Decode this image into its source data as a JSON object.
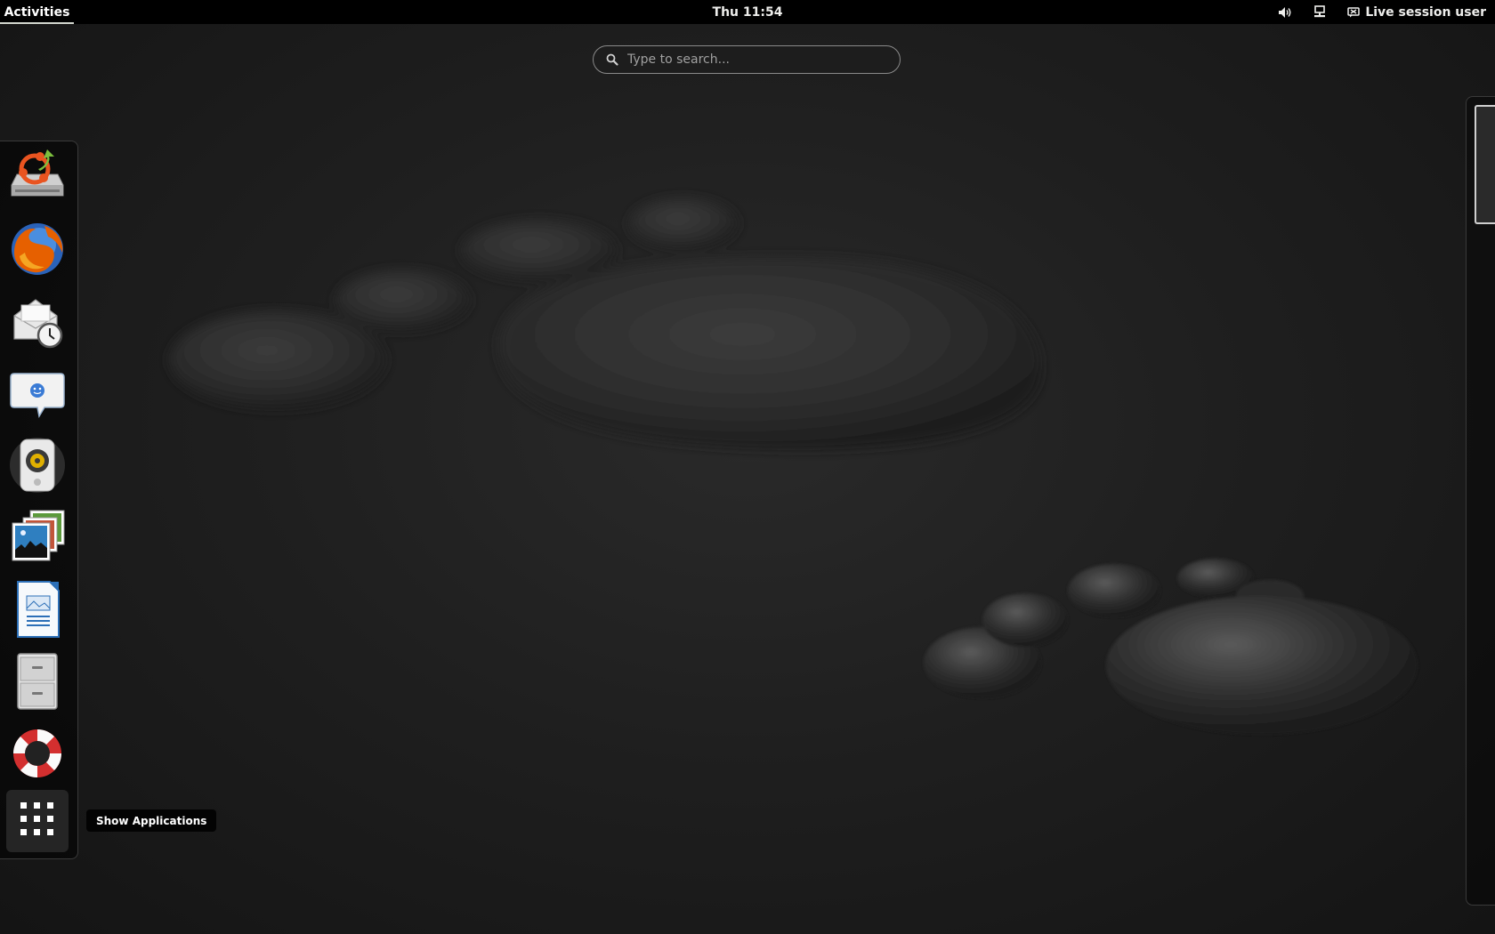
{
  "topbar": {
    "activities_label": "Activities",
    "clock": "Thu 11:54",
    "volume_icon": "volume-icon",
    "network_icon": "network-wired-icon",
    "user_icon": "live-session-icon",
    "user_label": "Live session user"
  },
  "search": {
    "placeholder": "Type to search...",
    "value": ""
  },
  "dash": {
    "items": [
      {
        "name": "ubiquity-installer",
        "icon": "installer-icon"
      },
      {
        "name": "firefox",
        "icon": "firefox-icon"
      },
      {
        "name": "evolution-mail",
        "icon": "mail-clock-icon"
      },
      {
        "name": "empathy-chat",
        "icon": "chat-bubble-icon"
      },
      {
        "name": "rhythmbox",
        "icon": "speaker-icon"
      },
      {
        "name": "shotwell-photos",
        "icon": "photos-icon"
      },
      {
        "name": "libreoffice-writer",
        "icon": "document-icon"
      },
      {
        "name": "files",
        "icon": "file-cabinet-icon"
      },
      {
        "name": "help",
        "icon": "lifebuoy-icon"
      }
    ],
    "show_apps_icon": "grid-icon",
    "tooltip": "Show Applications"
  },
  "colors": {
    "topbar_bg": "#000000",
    "accent_orange": "#e95420",
    "panel_text": "#eeeeec"
  }
}
